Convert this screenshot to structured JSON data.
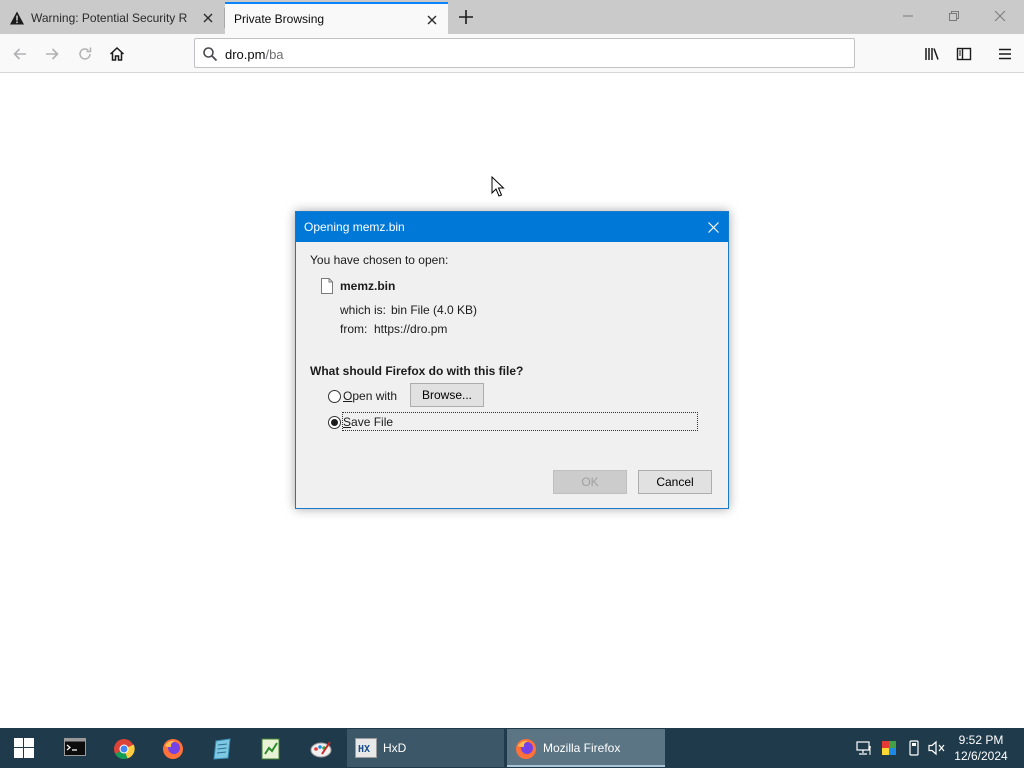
{
  "tabs": [
    {
      "title": "Warning: Potential Security Risk Ahead",
      "icon": "warning-icon",
      "active": false
    },
    {
      "title": "Private Browsing",
      "icon": "",
      "active": true
    }
  ],
  "urlbar": {
    "host": "dro.pm",
    "path": "/ba"
  },
  "dialog": {
    "title": "Opening memz.bin",
    "intro": "You have chosen to open:",
    "file_name": "memz.bin",
    "which_is_label": "which is:",
    "which_is_value": "bin File (4.0 KB)",
    "from_label": "from:",
    "from_value": "https://dro.pm",
    "question": "What should Firefox do with this file?",
    "open_with_label": "Open with",
    "browse_label": "Browse...",
    "save_file_label": "Save File",
    "selected_option": "save_file",
    "ok_label": "OK",
    "cancel_label": "Cancel"
  },
  "taskbar": {
    "pinned": [
      "start-icon",
      "terminal-icon",
      "chrome-icon",
      "firefox-icon",
      "notepad-icon",
      "spreadsheet-icon",
      "paint-icon"
    ],
    "tasks": [
      {
        "label": "HxD",
        "icon": "hxd-icon"
      },
      {
        "label": "Mozilla Firefox",
        "icon": "firefox-icon"
      }
    ],
    "tray": [
      "network-icon",
      "color-icon",
      "usb-icon",
      "volume-muted-icon"
    ],
    "time": "9:52 PM",
    "date": "12/6/2024"
  },
  "colors": {
    "accent": "#0078d7",
    "tab_accent": "#0a84ff",
    "taskbar": "#1f3a4a"
  }
}
